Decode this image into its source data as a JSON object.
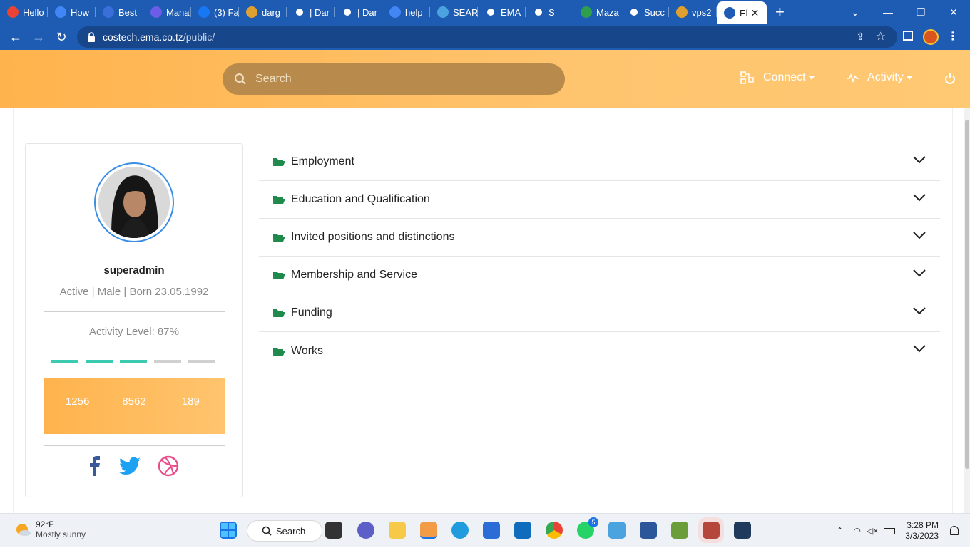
{
  "browser": {
    "tabs": [
      {
        "title": "Hello",
        "icon": "gmail-icon",
        "color": "#ea4335"
      },
      {
        "title": "How",
        "icon": "google-icon",
        "color": "#4285f4"
      },
      {
        "title": "Best",
        "icon": "uh-icon",
        "color": "#3a6fd8"
      },
      {
        "title": "Mana",
        "icon": "u-icon",
        "color": "#6c5ce7"
      },
      {
        "title": "(3) Fa",
        "icon": "facebook-icon",
        "color": "#1877f2"
      },
      {
        "title": "darg",
        "icon": "sail-icon",
        "color": "#e0a030"
      },
      {
        "title": "| Dar",
        "icon": "globe-icon",
        "color": "#ffffff"
      },
      {
        "title": "| Dar",
        "icon": "globe-icon",
        "color": "#ffffff"
      },
      {
        "title": "help",
        "icon": "google-icon",
        "color": "#4285f4"
      },
      {
        "title": "SEAR",
        "icon": "k-icon",
        "color": "#4aa3df"
      },
      {
        "title": "EMA",
        "icon": "globe-icon",
        "color": "#ffffff"
      },
      {
        "title": "S",
        "icon": "globe-icon",
        "color": "#ffffff"
      },
      {
        "title": "Maza",
        "icon": "leaf-icon",
        "color": "#2e9e4a"
      },
      {
        "title": "Succ",
        "icon": "globe-icon",
        "color": "#ffffff"
      },
      {
        "title": "vps2",
        "icon": "sail-icon",
        "color": "#e0a030"
      },
      {
        "title": "El",
        "icon": "globe-icon",
        "color": "#1e5cb3",
        "active": true
      }
    ],
    "url_host": "costech.ema.co.tz",
    "url_path": "/public/"
  },
  "header": {
    "search_placeholder": "Search",
    "connect_label": "Connect",
    "activity_label": "Activity"
  },
  "profile": {
    "username": "superadmin",
    "status_line": "Active | Male | Born 23.05.1992",
    "activity_level": "Activity Level: 87%",
    "activity_bars": [
      true,
      true,
      true,
      false,
      false
    ],
    "stats": [
      "1256",
      "8562",
      "189"
    ]
  },
  "accordion": [
    {
      "label": "Employment"
    },
    {
      "label": "Education and Qualification"
    },
    {
      "label": "Invited positions and distinctions"
    },
    {
      "label": "Membership and Service"
    },
    {
      "label": "Funding"
    },
    {
      "label": "Works"
    }
  ],
  "taskbar": {
    "temperature": "92°F",
    "weather": "Mostly sunny",
    "search_label": "Search",
    "whatsapp_badge": "5",
    "time": "3:28 PM",
    "date": "3/3/2023"
  },
  "colors": {
    "accent": "#ffb34d",
    "browser_chrome": "#1e5cb3",
    "teal": "#3ccab0",
    "folder_green": "#1f8a4c"
  }
}
